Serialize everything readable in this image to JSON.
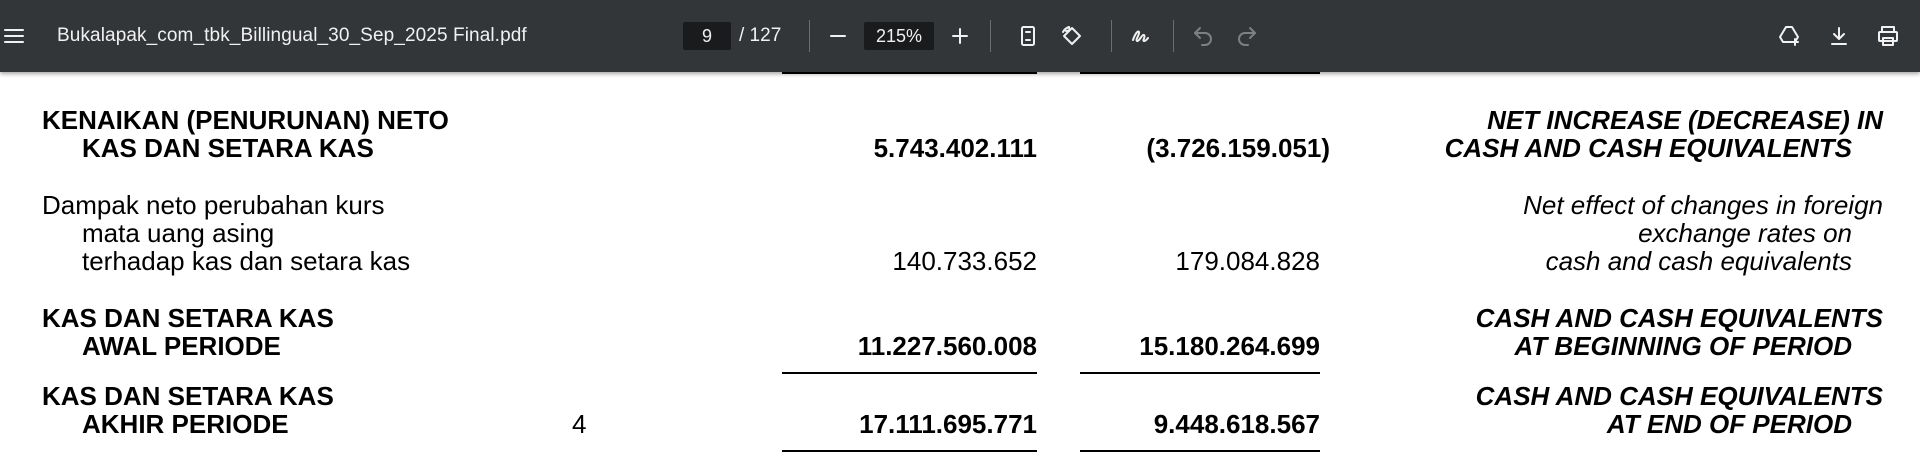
{
  "toolbar": {
    "menu_icon": "menu-icon",
    "title": "Bukalapak_com_tbk_Billingual_30_Sep_2025 Final.pdf",
    "page_current": "9",
    "page_total_text": "/ 127",
    "zoom": "215%",
    "icons": [
      "zoom-out-icon",
      "zoom-in-icon",
      "fit-page-icon",
      "rotate-icon",
      "annotate-icon",
      "undo-icon",
      "redo-icon",
      "save-drive-icon",
      "download-icon",
      "print-icon"
    ]
  },
  "statement": {
    "rows": [
      {
        "id": "net-increase",
        "label_line1": "KENAIKAN (PENURUNAN) NETO",
        "label_line2": "KAS DAN SETARA KAS",
        "note": "",
        "value_2025": "5.743.402.111",
        "value_2024": "(3.726.159.051)",
        "en_line1": "NET INCREASE (DECREASE) IN",
        "en_line2": "CASH AND CASH EQUIVALENTS"
      },
      {
        "id": "fx-effect",
        "label_line1": "Dampak neto perubahan kurs",
        "label_line2": "mata uang asing",
        "label_line3": "terhadap kas dan setara kas",
        "value_2025": "140.733.652",
        "value_2024": "179.084.828",
        "en_line1": "Net effect of changes in foreign",
        "en_line2": "exchange rates on",
        "en_line3": "cash and cash equivalents"
      },
      {
        "id": "beginning",
        "label_line1": "KAS DAN SETARA KAS",
        "label_line2": "AWAL PERIODE",
        "value_2025": "11.227.560.008",
        "value_2024": "15.180.264.699",
        "en_line1": "CASH AND CASH EQUIVALENTS",
        "en_line2": "AT BEGINNING OF PERIOD"
      },
      {
        "id": "end",
        "label_line1": "KAS DAN SETARA KAS",
        "label_line2": "AKHIR PERIODE",
        "note": "4",
        "value_2025": "17.111.695.771",
        "value_2024": "9.448.618.567",
        "en_line1": "CASH AND CASH EQUIVALENTS",
        "en_line2": "AT END OF PERIOD"
      }
    ]
  }
}
